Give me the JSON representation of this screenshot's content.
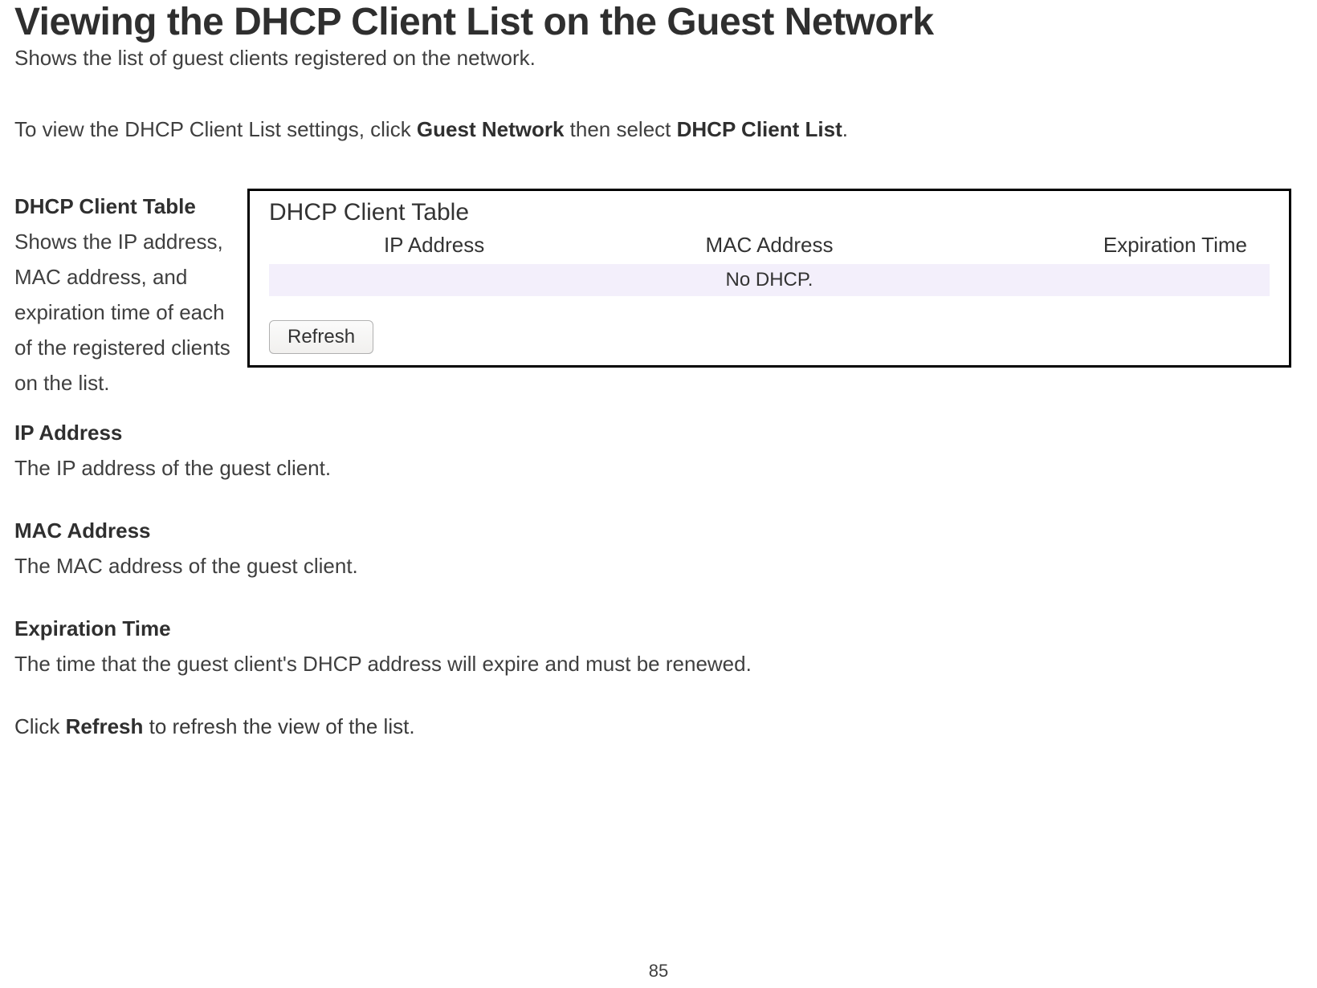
{
  "heading": "Viewing the DHCP Client List on the Guest Network",
  "subheading": "Shows the list of guest clients registered on the network.",
  "nav": {
    "prefix": "To view the DHCP Client List settings, click ",
    "bold1": "Guest Network",
    "mid": " then select ",
    "bold2": "DHCP Client List",
    "suffix": "."
  },
  "dhcp_client_table": {
    "term": "DHCP Client Table",
    "desc": "Shows the IP address, MAC address, and expiration time of each of the registered clients on the list."
  },
  "figure": {
    "title": "DHCP Client Table",
    "columns": {
      "ip": "IP Address",
      "mac": "MAC Address",
      "exp": "Expiration Time"
    },
    "empty_text": "No DHCP.",
    "refresh_label": "Refresh"
  },
  "definitions": [
    {
      "term": "IP Address",
      "desc": "The IP address of the guest client."
    },
    {
      "term": "MAC Address",
      "desc": "The MAC address of the guest client."
    },
    {
      "term": "Expiration Time",
      "desc": "The time that the guest client's DHCP address will expire and must be renewed."
    }
  ],
  "refresh_line": {
    "prefix": "Click ",
    "bold": "Refresh",
    "suffix": " to refresh the view of the list."
  },
  "page_number": "85"
}
